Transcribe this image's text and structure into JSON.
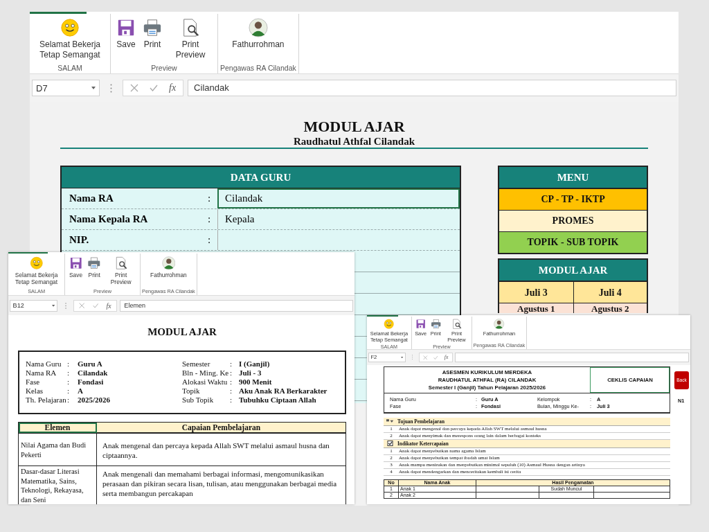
{
  "windows": [
    {
      "kind": "data_guru",
      "ribbon": {
        "groups": [
          {
            "label": "SALAM",
            "buttons": [
              {
                "kind": "smiley",
                "label": "Selamat Bekerja Tetap Semangat"
              }
            ]
          },
          {
            "label": "Preview",
            "buttons": [
              {
                "kind": "save",
                "label": "Save"
              },
              {
                "kind": "print",
                "label": "Print"
              },
              {
                "kind": "preview",
                "label": "Print Preview"
              }
            ]
          },
          {
            "label": "Pengawas RA Cilandak",
            "buttons": [
              {
                "kind": "avatar",
                "label": "Fathurrohman"
              }
            ]
          }
        ]
      },
      "formula_bar": {
        "name_box": "D7",
        "fx": "fx",
        "value": "Cilandak"
      },
      "title": "MODUL AJAR",
      "subtitle": "Raudhatul Athfal Cilandak",
      "data_guru": {
        "heading": "DATA GURU",
        "rows": [
          {
            "label": "Nama RA",
            "separator": ":",
            "value": "Cilandak",
            "selected": true
          },
          {
            "label": "Nama Kepala RA",
            "separator": ":",
            "value": "Kepala",
            "selected": false
          },
          {
            "label": "NIP.",
            "separator": ":",
            "selected": false
          }
        ]
      },
      "menu": {
        "heading": "MENU",
        "items": [
          {
            "label": "CP - TP - IKTP",
            "color": "#ffc000"
          },
          {
            "label": "PROMES",
            "color": "#fff2cc"
          },
          {
            "label": "TOPIK - SUB TOPIK",
            "color": "#92d050"
          }
        ]
      },
      "modul_ajar": {
        "heading": "MODUL AJAR",
        "items": [
          {
            "label": "Juli 3",
            "color": "#ffe699"
          },
          {
            "label": "Juli 4",
            "color": "#ffe699"
          },
          {
            "label": "Agustus 1",
            "color": "#fbe2d5"
          },
          {
            "label": "Agustus 2",
            "color": "#fbe2d5"
          }
        ]
      }
    },
    {
      "kind": "modul",
      "ribbon": {
        "groups": [
          {
            "label": "SALAM",
            "buttons": [
              {
                "kind": "smiley",
                "label": "Selamat Bekerja Tetap Semangat"
              }
            ]
          },
          {
            "label": "Preview",
            "buttons": [
              {
                "kind": "save",
                "label": "Save"
              },
              {
                "kind": "print",
                "label": "Print"
              },
              {
                "kind": "preview",
                "label": "Print Preview"
              }
            ]
          },
          {
            "label": "Pengawas RA Cilandak",
            "buttons": [
              {
                "kind": "avatar",
                "label": "Fathurrohman"
              }
            ]
          }
        ]
      },
      "formula_bar": {
        "name_box": "B12",
        "fx": "fx",
        "value": "Elemen"
      },
      "title": "MODUL AJAR",
      "info": {
        "left": [
          {
            "label": "Nama Guru",
            "separator": ":",
            "value": "Guru A"
          },
          {
            "label": "Nama RA",
            "separator": ":",
            "value": "Cilandak"
          },
          {
            "label": "Fase",
            "separator": ":",
            "value": "Fondasi"
          },
          {
            "label": "Kelas",
            "separator": ":",
            "value": "A"
          },
          {
            "label": "Th. Pelajaran",
            "separator": ":",
            "value": "2025/2026"
          }
        ],
        "right": [
          {
            "label": "Semester",
            "separator": ":",
            "value": "I (Ganjil)"
          },
          {
            "label": "Bln - Ming. Ke",
            "separator": ":",
            "value": "Juli - 3"
          },
          {
            "label": "Alokasi Waktu",
            "separator": ":",
            "value": "900 Menit"
          },
          {
            "label": "Topik",
            "separator": ":",
            "value": "Aku Anak RA Berkarakter"
          },
          {
            "label": "Sub Topik",
            "separator": ":",
            "value": "Tubuhku Ciptaan Allah"
          }
        ]
      },
      "table": {
        "columns": [
          {
            "label": "Elemen",
            "selected": true
          },
          {
            "label": "Capaian Pembelajaran",
            "selected": false
          }
        ],
        "rows": [
          {
            "element": "Nilai Agama dan Budi Pekerti",
            "achievement": "Anak mengenal dan percaya kepada Allah SWT melalui asmaul husna dan ciptaannya."
          },
          {
            "element": "Dasar-dasar Literasi Matematika, Sains, Teknologi, Rekayasa, dan Seni",
            "achievement": "Anak mengenali dan memahami berbagai informasi, mengomunikasikan perasaan dan pikiran secara lisan, tulisan, atau menggunakan berbagai media serta membangun percakapan"
          }
        ]
      }
    },
    {
      "kind": "ceklis",
      "ribbon": {
        "groups": [
          {
            "label": "SALAM",
            "buttons": [
              {
                "kind": "smiley",
                "label": "Selamat Bekerja Tetap Semangat"
              }
            ]
          },
          {
            "label": "Preview",
            "buttons": [
              {
                "kind": "save",
                "label": "Save"
              },
              {
                "kind": "print",
                "label": "Print"
              },
              {
                "kind": "preview",
                "label": "Print Preview"
              }
            ]
          },
          {
            "label": "Pengawas RA Cilandak",
            "buttons": [
              {
                "kind": "avatar",
                "label": "Fathurrohman"
              }
            ]
          }
        ]
      },
      "formula_bar": {
        "name_box": "F2",
        "fx": "fx"
      },
      "header": {
        "lines": [
          "ASESMEN KURIKULUM MERDEKA",
          "RAUDHATUL ATHFAL (RA) CILANDAK",
          "Semester I (Ganjil) Tahun Pelajaran 2025/2026"
        ],
        "tag": {
          "label": "CEKLIS CAPAIAN",
          "selected": true
        }
      },
      "back": "Back",
      "code": "N1",
      "info": [
        {
          "label": "Nama Guru",
          "separator": ":",
          "value": "Guru A",
          "label_2": "Kelompok",
          "separator_2": ":",
          "value_2": "A"
        },
        {
          "label": "Fase",
          "separator": ":",
          "value": "Fondasi",
          "label_2": "Bulan, Minggu Ke-",
          "separator_2": ":",
          "value_2": "Juli 3"
        }
      ],
      "sections": [
        {
          "kind": "goals",
          "heading": "Tujuan Pembelajaran",
          "items": [
            {
              "no": "1",
              "text": "Anak dapat mengenal dan percaya kepada Allah SWT melalui asmaul husna"
            },
            {
              "no": "2",
              "text": "Anak dapat menyimak dan merespons orang lain dalam berbagai konteks"
            }
          ]
        },
        {
          "kind": "indicators",
          "heading": "Indikator Ketercapaian",
          "items": [
            {
              "no": "1",
              "text": "Anak dapat menyebutkan nama agama Islam"
            },
            {
              "no": "2",
              "text": "Anak dapat menyebutkan tempat ibadah umat Islam"
            },
            {
              "no": "3",
              "text": "Anak mampu menirukan dan menyebutkan minimal sepuluh (10) Asmaul Husna dengan artinya"
            },
            {
              "no": "4",
              "text": "Anak dapat mendengarkan dan menceritakan kembali isi cerita"
            }
          ]
        }
      ],
      "table": {
        "columns": [
          "No",
          "Nama Anak",
          "Hasil Pengamatan"
        ],
        "rows": [
          {
            "no": "1",
            "name": "Anak 1",
            "result": "Sudah Muncul"
          },
          {
            "no": "2",
            "name": "Anak 2"
          }
        ]
      }
    }
  ]
}
